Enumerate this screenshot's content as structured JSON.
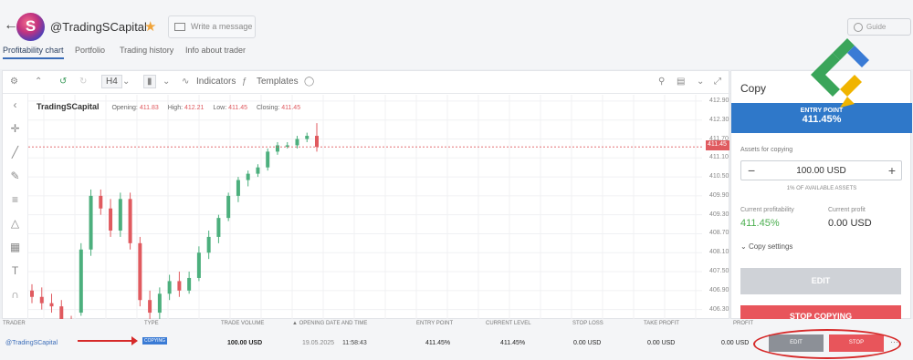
{
  "header": {
    "trader_name": "@TradingSCapital",
    "message_placeholder": "Write a message",
    "guide_label": "Guide"
  },
  "tabs": [
    {
      "label": "Profitability chart",
      "active": true
    },
    {
      "label": "Portfolio"
    },
    {
      "label": "Trading history"
    },
    {
      "label": "Info about trader"
    }
  ],
  "toolbar": {
    "timeframe": "H4",
    "indicators_label": "Indicators",
    "templates_label": "Templates"
  },
  "chart_data": {
    "type": "candlestick",
    "title": "TradingSCapital",
    "ohlc_legend": {
      "Opening": "411.83",
      "High": "412.21",
      "Low": "411.45",
      "Closing": "411.45"
    },
    "y_ticks": [
      "412.90",
      "412.30",
      "411.70",
      "411.10",
      "410.50",
      "409.90",
      "409.30",
      "408.70",
      "408.10",
      "407.50",
      "406.90",
      "406.30"
    ],
    "ylim": [
      406.0,
      413.1
    ],
    "current_price": "411.45",
    "candles": [
      [
        406.9,
        407.1,
        406.5,
        406.7
      ],
      [
        406.7,
        407.0,
        406.3,
        406.5
      ],
      [
        406.5,
        406.8,
        406.2,
        406.4
      ],
      [
        406.4,
        406.6,
        405.7,
        405.9
      ],
      [
        405.9,
        406.1,
        405.6,
        405.7
      ],
      [
        406.2,
        408.4,
        406.1,
        408.2
      ],
      [
        408.2,
        410.1,
        408.0,
        409.9
      ],
      [
        409.9,
        410.1,
        409.3,
        409.5
      ],
      [
        409.5,
        409.8,
        408.6,
        408.8
      ],
      [
        408.8,
        410.0,
        408.6,
        409.8
      ],
      [
        409.8,
        410.0,
        408.2,
        408.4
      ],
      [
        408.4,
        408.6,
        406.4,
        406.6
      ],
      [
        406.6,
        406.9,
        406.0,
        406.2
      ],
      [
        406.2,
        407.0,
        406.0,
        406.8
      ],
      [
        406.8,
        407.4,
        406.6,
        407.2
      ],
      [
        407.2,
        407.5,
        406.7,
        406.9
      ],
      [
        406.9,
        407.5,
        406.8,
        407.3
      ],
      [
        407.3,
        408.3,
        407.2,
        408.1
      ],
      [
        408.1,
        408.8,
        407.9,
        408.6
      ],
      [
        408.6,
        409.3,
        408.4,
        409.2
      ],
      [
        409.2,
        410.0,
        409.1,
        409.9
      ],
      [
        409.9,
        410.5,
        409.7,
        410.4
      ],
      [
        410.4,
        410.7,
        410.2,
        410.6
      ],
      [
        410.6,
        410.9,
        410.5,
        410.8
      ],
      [
        410.8,
        411.4,
        410.7,
        411.3
      ],
      [
        411.3,
        411.6,
        411.2,
        411.5
      ],
      [
        411.5,
        411.6,
        411.4,
        411.5
      ],
      [
        411.5,
        411.8,
        411.4,
        411.7
      ],
      [
        411.7,
        411.9,
        411.6,
        411.8
      ],
      [
        411.8,
        412.2,
        411.3,
        411.45
      ]
    ]
  },
  "copy_panel": {
    "title": "Copy",
    "entry_point_label": "ENTRY POINT",
    "entry_point_value": "411.45%",
    "assets_label": "Assets for copying",
    "amount": "100.00 USD",
    "available": "1% OF AVAILABLE ASSETS",
    "current_profitability_label": "Current profitability",
    "current_profitability": "411.45%",
    "current_profit_label": "Current profit",
    "current_profit": "0.00 USD",
    "copy_settings_label": "Copy settings",
    "edit_label": "EDIT",
    "stop_label": "STOP COPYING",
    "profit_color": "#4caf50"
  },
  "table": {
    "headers": [
      "TRADER",
      "TYPE",
      "TRADE VOLUME",
      "▲ OPENING DATE AND TIME",
      "ENTRY POINT",
      "CURRENT LEVEL",
      "STOP LOSS",
      "TAKE PROFIT",
      "PROFIT"
    ],
    "row": {
      "trader": "@TradingSCapital",
      "type": "COPYING",
      "volume": "100.00 USD",
      "date": "19.05.2025",
      "time": "11:58:43",
      "entry": "411.45%",
      "current": "411.45%",
      "stop_loss": "0.00 USD",
      "take_profit": "0.00 USD",
      "profit": "0.00 USD",
      "edit_label": "EDIT",
      "stop_label": "STOP"
    }
  },
  "colors": {
    "up": "#4caf7d",
    "down": "#e05a5f",
    "accent": "#2f78c9"
  }
}
